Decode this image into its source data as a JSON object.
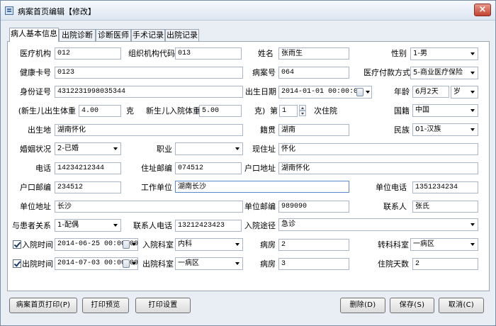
{
  "window": {
    "title": "病案首页编辑【修改】",
    "close_label": "×"
  },
  "tabs": [
    "病人基本信息",
    "出院诊断",
    "诊断医师",
    "手术记录",
    "出院记录"
  ],
  "form": {
    "org_label": "医疗机构",
    "org_value": "012",
    "orgcode_label": "组织机构代码",
    "orgcode_value": "013",
    "name_label": "姓名",
    "name_value": "张雨生",
    "gender_label": "性别",
    "gender_value": "1-男",
    "healthcard_label": "健康卡号",
    "healthcard_value": "0123",
    "caseno_label": "病案号",
    "caseno_value": "064",
    "payment_label": "医疗付款方式",
    "payment_value": "5-商业医疗保险",
    "idcard_label": "身份证号",
    "idcard_value": "4312231998035344",
    "birth_label": "出生日期",
    "birth_value": "2014-01-01 00:00:00",
    "age_label": "年龄",
    "age_value": "6月2天",
    "age_unit": "岁",
    "nbweight_label": "(新生儿出生体重",
    "nbweight_value": "4.00",
    "nbweight_unit": "克",
    "nbadmit_label": "新生儿入院体重",
    "nbadmit_value": "5.00",
    "nbadmit_unit": "克)",
    "times_prefix": "第",
    "times_value": "1",
    "times_suffix": "次住院",
    "nationality_label": "国籍",
    "nationality_value": "中国",
    "birthplace_label": "出生地",
    "birthplace_value": "湖南怀化",
    "native_label": "籍贯",
    "native_value": "湖南",
    "ethnic_label": "民族",
    "ethnic_value": "01-汉族",
    "marital_label": "婚姻状况",
    "marital_value": "2-已婚",
    "job_label": "职业",
    "job_value": "",
    "address_label": "现住址",
    "address_value": "怀化",
    "phone_label": "电话",
    "phone_value": "14234212344",
    "zip_label": "住址邮编",
    "zip_value": "074512",
    "hukou_label": "户口地址",
    "hukou_value": "湖南怀化",
    "hukouzip_label": "户口邮编",
    "hukouzip_value": "234512",
    "workunit_label": "工作单位",
    "workunit_value": "湖南长沙",
    "unitphone_label": "单位电话",
    "unitphone_value": "1351234234",
    "unitaddr_label": "单位地址",
    "unitaddr_value": "长沙",
    "unitzip_label": "单位邮编",
    "unitzip_value": "989090",
    "contact_label": "联系人",
    "contact_value": "张氏",
    "relation_label": "与患者关系",
    "relation_value": "1-配偶",
    "contactphone_label": "联系人电话",
    "contactphone_value": "13212423423",
    "admitway_label": "入院途径",
    "admitway_value": "急诊",
    "admittime_label": "入院时间",
    "admittime_value": "2014-06-25 00:00:00",
    "admitdept_label": "入院科室",
    "admitdept_value": "内科",
    "ward1_label": "病房",
    "ward1_value": "2",
    "transfer_label": "转科科室",
    "transfer_value": "一病区",
    "distime_label": "出院时间",
    "distime_value": "2014-07-03 00:00:00",
    "disdept_label": "出院科室",
    "disdept_value": "一病区",
    "ward2_label": "病房",
    "ward2_value": "3",
    "days_label": "住院天数",
    "days_value": "2"
  },
  "buttons": {
    "print": "病案首页打印(P)",
    "preview": "打印预览",
    "settings": "打印设置",
    "delete": "删除(D)",
    "save": "保存(S)",
    "cancel": "取消(C)"
  }
}
